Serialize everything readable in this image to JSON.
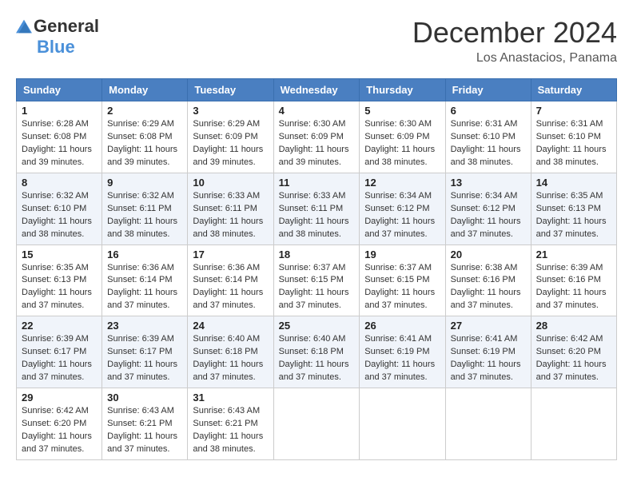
{
  "header": {
    "logo_general": "General",
    "logo_blue": "Blue",
    "month_title": "December 2024",
    "location": "Los Anastacios, Panama"
  },
  "weekdays": [
    "Sunday",
    "Monday",
    "Tuesday",
    "Wednesday",
    "Thursday",
    "Friday",
    "Saturday"
  ],
  "weeks": [
    [
      {
        "day": "1",
        "sunrise": "6:28 AM",
        "sunset": "6:08 PM",
        "daylight": "11 hours and 39 minutes."
      },
      {
        "day": "2",
        "sunrise": "6:29 AM",
        "sunset": "6:08 PM",
        "daylight": "11 hours and 39 minutes."
      },
      {
        "day": "3",
        "sunrise": "6:29 AM",
        "sunset": "6:09 PM",
        "daylight": "11 hours and 39 minutes."
      },
      {
        "day": "4",
        "sunrise": "6:30 AM",
        "sunset": "6:09 PM",
        "daylight": "11 hours and 39 minutes."
      },
      {
        "day": "5",
        "sunrise": "6:30 AM",
        "sunset": "6:09 PM",
        "daylight": "11 hours and 38 minutes."
      },
      {
        "day": "6",
        "sunrise": "6:31 AM",
        "sunset": "6:10 PM",
        "daylight": "11 hours and 38 minutes."
      },
      {
        "day": "7",
        "sunrise": "6:31 AM",
        "sunset": "6:10 PM",
        "daylight": "11 hours and 38 minutes."
      }
    ],
    [
      {
        "day": "8",
        "sunrise": "6:32 AM",
        "sunset": "6:10 PM",
        "daylight": "11 hours and 38 minutes."
      },
      {
        "day": "9",
        "sunrise": "6:32 AM",
        "sunset": "6:11 PM",
        "daylight": "11 hours and 38 minutes."
      },
      {
        "day": "10",
        "sunrise": "6:33 AM",
        "sunset": "6:11 PM",
        "daylight": "11 hours and 38 minutes."
      },
      {
        "day": "11",
        "sunrise": "6:33 AM",
        "sunset": "6:11 PM",
        "daylight": "11 hours and 38 minutes."
      },
      {
        "day": "12",
        "sunrise": "6:34 AM",
        "sunset": "6:12 PM",
        "daylight": "11 hours and 37 minutes."
      },
      {
        "day": "13",
        "sunrise": "6:34 AM",
        "sunset": "6:12 PM",
        "daylight": "11 hours and 37 minutes."
      },
      {
        "day": "14",
        "sunrise": "6:35 AM",
        "sunset": "6:13 PM",
        "daylight": "11 hours and 37 minutes."
      }
    ],
    [
      {
        "day": "15",
        "sunrise": "6:35 AM",
        "sunset": "6:13 PM",
        "daylight": "11 hours and 37 minutes."
      },
      {
        "day": "16",
        "sunrise": "6:36 AM",
        "sunset": "6:14 PM",
        "daylight": "11 hours and 37 minutes."
      },
      {
        "day": "17",
        "sunrise": "6:36 AM",
        "sunset": "6:14 PM",
        "daylight": "11 hours and 37 minutes."
      },
      {
        "day": "18",
        "sunrise": "6:37 AM",
        "sunset": "6:15 PM",
        "daylight": "11 hours and 37 minutes."
      },
      {
        "day": "19",
        "sunrise": "6:37 AM",
        "sunset": "6:15 PM",
        "daylight": "11 hours and 37 minutes."
      },
      {
        "day": "20",
        "sunrise": "6:38 AM",
        "sunset": "6:16 PM",
        "daylight": "11 hours and 37 minutes."
      },
      {
        "day": "21",
        "sunrise": "6:39 AM",
        "sunset": "6:16 PM",
        "daylight": "11 hours and 37 minutes."
      }
    ],
    [
      {
        "day": "22",
        "sunrise": "6:39 AM",
        "sunset": "6:17 PM",
        "daylight": "11 hours and 37 minutes."
      },
      {
        "day": "23",
        "sunrise": "6:39 AM",
        "sunset": "6:17 PM",
        "daylight": "11 hours and 37 minutes."
      },
      {
        "day": "24",
        "sunrise": "6:40 AM",
        "sunset": "6:18 PM",
        "daylight": "11 hours and 37 minutes."
      },
      {
        "day": "25",
        "sunrise": "6:40 AM",
        "sunset": "6:18 PM",
        "daylight": "11 hours and 37 minutes."
      },
      {
        "day": "26",
        "sunrise": "6:41 AM",
        "sunset": "6:19 PM",
        "daylight": "11 hours and 37 minutes."
      },
      {
        "day": "27",
        "sunrise": "6:41 AM",
        "sunset": "6:19 PM",
        "daylight": "11 hours and 37 minutes."
      },
      {
        "day": "28",
        "sunrise": "6:42 AM",
        "sunset": "6:20 PM",
        "daylight": "11 hours and 37 minutes."
      }
    ],
    [
      {
        "day": "29",
        "sunrise": "6:42 AM",
        "sunset": "6:20 PM",
        "daylight": "11 hours and 37 minutes."
      },
      {
        "day": "30",
        "sunrise": "6:43 AM",
        "sunset": "6:21 PM",
        "daylight": "11 hours and 37 minutes."
      },
      {
        "day": "31",
        "sunrise": "6:43 AM",
        "sunset": "6:21 PM",
        "daylight": "11 hours and 38 minutes."
      },
      null,
      null,
      null,
      null
    ]
  ]
}
